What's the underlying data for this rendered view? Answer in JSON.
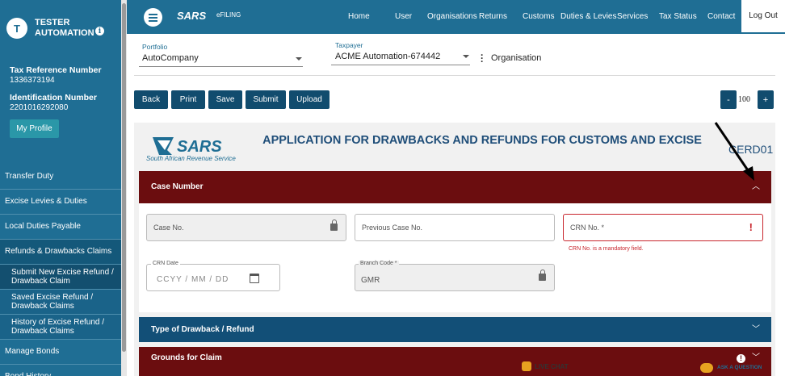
{
  "user": {
    "initial": "T",
    "name": "TESTER AUTOMATION"
  },
  "tax_ref": {
    "label": "Tax Reference Number",
    "value": "1336373194"
  },
  "id_number": {
    "label": "Identification Number",
    "value": "2201016292080"
  },
  "profile_button": "My Profile",
  "nav": {
    "items": [
      "Transfer Duty",
      "Excise Levies & Duties",
      "Local Duties Payable",
      "Refunds & Drawbacks Claims"
    ],
    "sub_items": [
      "Submit New Excise Refund / Drawback Claim",
      "Saved Excise Refund / Drawback Claims",
      "History of Excise Refund / Drawback Claims"
    ],
    "after_items": [
      "Manage Bonds",
      "Bond History"
    ]
  },
  "topbar": {
    "logo": "SARS",
    "efiling": "eFILING",
    "menu": [
      "Home",
      "User",
      "Organisations",
      "Returns",
      "Customs",
      "Duties & Levies",
      "Services",
      "Tax Status",
      "Contact"
    ],
    "logout": "Log Out"
  },
  "portfolio": {
    "label": "Portfolio",
    "value": "AutoCompany"
  },
  "taxpayer": {
    "label": "Taxpayer",
    "value": "ACME Automation-674442"
  },
  "organisation": "Organisation",
  "buttons": [
    "Back",
    "Print",
    "Save",
    "Submit",
    "Upload"
  ],
  "zoom": {
    "minus": "-",
    "value": "100",
    "plus": "+"
  },
  "form": {
    "logo_text": "SARS",
    "logo_sub": "South African Revenue Service",
    "title": "APPLICATION FOR DRAWBACKS AND REFUNDS FOR CUSTOMS AND EXCISE",
    "code": "CERD01"
  },
  "sections": {
    "case": "Case Number",
    "type": "Type of Drawback / Refund",
    "grounds": "Grounds for Claim"
  },
  "fields": {
    "case_no": "Case No.",
    "prev_case_no": "Previous Case No.",
    "crn_no": "CRN No. *",
    "crn_error": "CRN No. is a mandatory field.",
    "crn_date_label": "CRN Date",
    "crn_date_ph": "CCYY / MM / DD",
    "branch_label": "Branch Code *",
    "branch_value": "GMR"
  },
  "chat": {
    "live": "LIVE CHAT",
    "ask": "ASK A QUESTION"
  },
  "colors": {
    "primary": "#1f6e94",
    "section_red": "#6b0d0f",
    "section_blue": "#124f77",
    "error": "#c8262d"
  }
}
